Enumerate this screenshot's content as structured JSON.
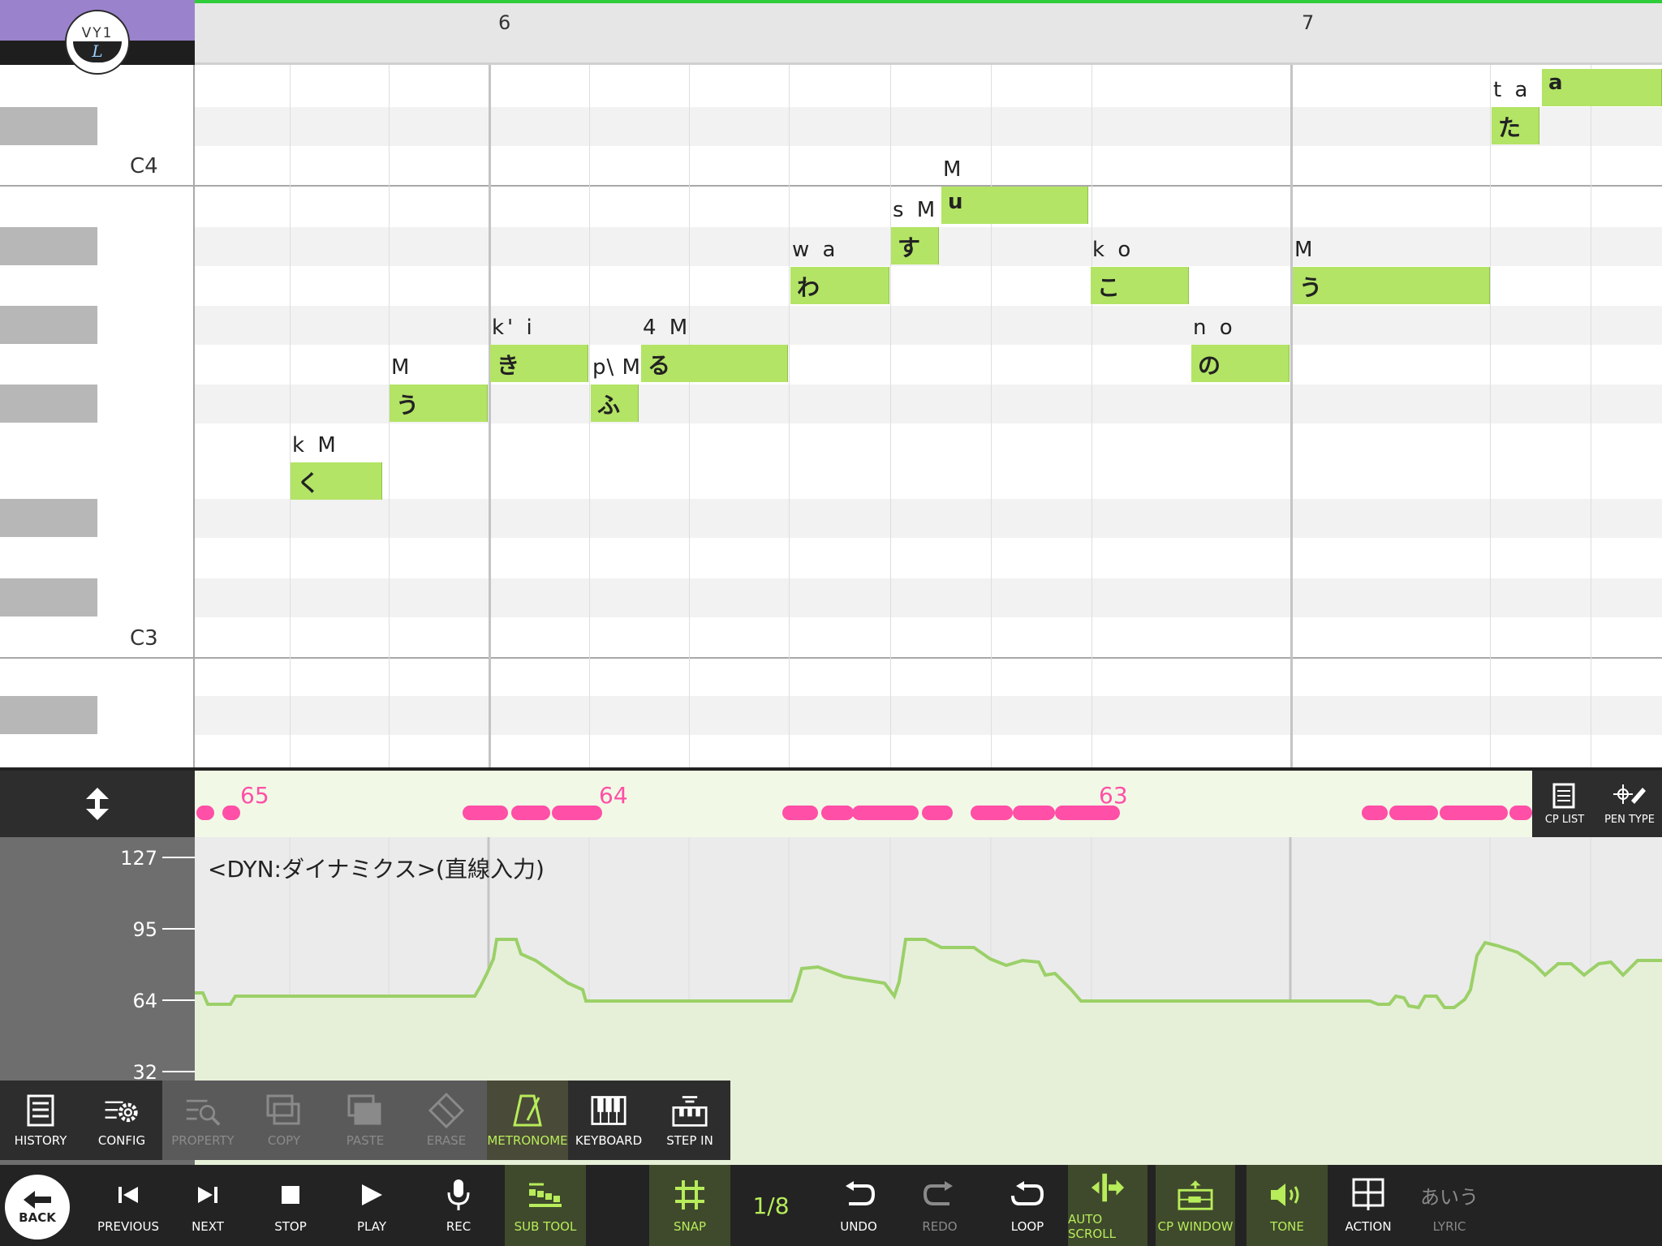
{
  "ruler": {
    "measures": [
      "6",
      "7"
    ]
  },
  "keys": {
    "c4": "C4",
    "c3": "C3"
  },
  "notes": [
    {
      "lyric": "く",
      "phoneme": "k M"
    },
    {
      "lyric": "う",
      "phoneme": "M"
    },
    {
      "lyric": "き",
      "phoneme": "k' i"
    },
    {
      "lyric": "ふ",
      "phoneme": "p\\ M"
    },
    {
      "lyric": "る",
      "phoneme": "4 M"
    },
    {
      "lyric": "わ",
      "phoneme": "w a"
    },
    {
      "lyric": "す",
      "phoneme": "s M"
    },
    {
      "lyric": "u",
      "phoneme": "M"
    },
    {
      "lyric": "こ",
      "phoneme": "k o"
    },
    {
      "lyric": "の",
      "phoneme": "n o"
    },
    {
      "lyric": "う",
      "phoneme": "M"
    },
    {
      "lyric": "た",
      "phoneme": "t a"
    },
    {
      "lyric": "a",
      "phoneme": ""
    }
  ],
  "velocity_labels": [
    "65",
    "64",
    "63"
  ],
  "param_panel": {
    "title": "<DYN:ダイナミクス>(直線入力)",
    "axis": [
      "127",
      "95",
      "64",
      "32"
    ]
  },
  "right_tools": {
    "cp_list": "CP LIST",
    "pen_type": "PEN TYPE"
  },
  "edit_toolbar": [
    {
      "label": "HISTORY",
      "icon": "history-icon"
    },
    {
      "label": "CONFIG",
      "icon": "config-icon"
    },
    {
      "label": "PROPERTY",
      "icon": "property-icon"
    },
    {
      "label": "COPY",
      "icon": "copy-icon"
    },
    {
      "label": "PASTE",
      "icon": "paste-icon"
    },
    {
      "label": "ERASE",
      "icon": "erase-icon"
    },
    {
      "label": "METRONOME",
      "icon": "metronome-icon"
    },
    {
      "label": "KEYBOARD",
      "icon": "keyboard-icon"
    },
    {
      "label": "STEP IN",
      "icon": "step-in-icon"
    }
  ],
  "main_toolbar": {
    "back": "BACK",
    "previous": "PREVIOUS",
    "next": "NEXT",
    "stop": "STOP",
    "play": "PLAY",
    "rec": "REC",
    "sub_tool": "SUB TOOL",
    "snap": "SNAP",
    "snap_value": "1/8",
    "undo": "UNDO",
    "redo": "REDO",
    "loop": "LOOP",
    "auto_scroll": "AUTO SCROLL",
    "cp_window": "CP WINDOW",
    "tone": "TONE",
    "action": "ACTION",
    "lyric": "LYRIC",
    "lyric_icon_text": "あいう"
  },
  "colors": {
    "note": "#b3e465",
    "velocity": "#ff4fa7",
    "accent": "#b7ec5a",
    "header_purple": "#9b82cc",
    "ruler_top": "#2fcc3a"
  }
}
